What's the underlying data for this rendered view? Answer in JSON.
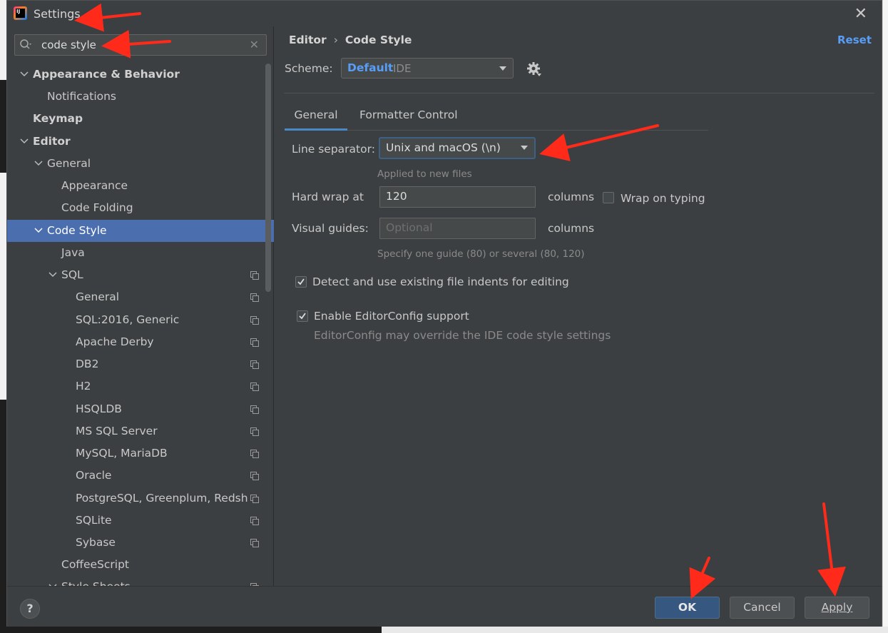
{
  "window": {
    "title": "Settings",
    "logo_text": "IJ"
  },
  "search": {
    "value": "code style"
  },
  "sidebar": {
    "items": [
      {
        "label": "Appearance & Behavior"
      },
      {
        "label": "Notifications"
      },
      {
        "label": "Keymap"
      },
      {
        "label": "Editor"
      },
      {
        "label": "General"
      },
      {
        "label": "Appearance"
      },
      {
        "label": "Code Folding"
      },
      {
        "label": "Code Style"
      },
      {
        "label": "Java"
      },
      {
        "label": "SQL"
      },
      {
        "label": "General"
      },
      {
        "label": "SQL:2016, Generic"
      },
      {
        "label": "Apache Derby"
      },
      {
        "label": "DB2"
      },
      {
        "label": "H2"
      },
      {
        "label": "HSQLDB"
      },
      {
        "label": "MS SQL Server"
      },
      {
        "label": "MySQL, MariaDB"
      },
      {
        "label": "Oracle"
      },
      {
        "label": "PostgreSQL, Greenplum, Redshift"
      },
      {
        "label": "SQLite"
      },
      {
        "label": "Sybase"
      },
      {
        "label": "CoffeeScript"
      },
      {
        "label": "Style Sheets"
      }
    ]
  },
  "main": {
    "breadcrumb": {
      "parent": "Editor",
      "separator": "›",
      "current": "Code Style"
    },
    "reset_label": "Reset",
    "scheme": {
      "label": "Scheme:",
      "name": "Default",
      "kind": "IDE"
    },
    "tabs": [
      {
        "label": "General"
      },
      {
        "label": "Formatter Control"
      }
    ],
    "line_separator": {
      "label": "Line separator:",
      "value": "Unix and macOS (\\n)",
      "hint": "Applied to new files"
    },
    "hard_wrap": {
      "label": "Hard wrap at",
      "value": "120",
      "unit": "columns",
      "wrap_on_typing_label": "Wrap on typing",
      "wrap_on_typing": false
    },
    "visual_guides": {
      "label": "Visual guides:",
      "placeholder": "Optional",
      "unit": "columns",
      "hint": "Specify one guide (80) or several (80, 120)"
    },
    "detect_indents": {
      "label": "Detect and use existing file indents for editing",
      "checked": true
    },
    "editorconfig": {
      "label": "Enable EditorConfig support",
      "checked": true,
      "hint": "EditorConfig may override the IDE code style settings"
    }
  },
  "footer": {
    "help_label": "?",
    "ok_label": "OK",
    "cancel_label": "Cancel",
    "apply_label": "Apply"
  },
  "colors": {
    "accent": "#589df6",
    "selection": "#4b6eaf",
    "background": "#3c3f41",
    "annotation": "#ff2a1a"
  }
}
